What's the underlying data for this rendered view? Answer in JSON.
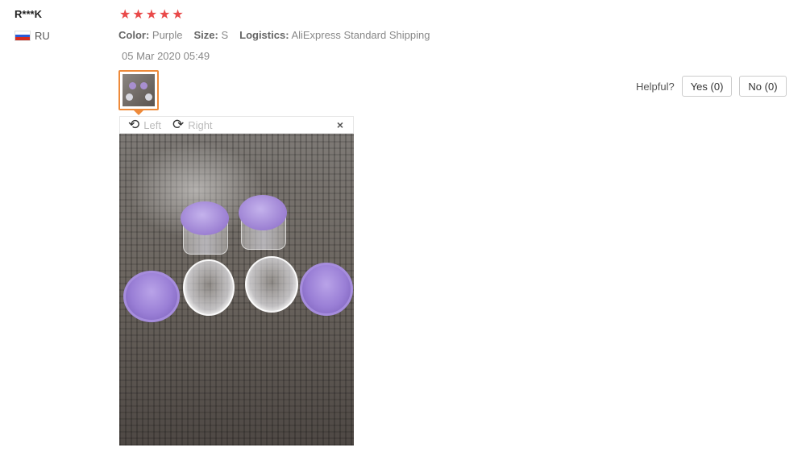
{
  "buyer": {
    "name": "R***K",
    "country": "RU"
  },
  "review": {
    "rating": 5,
    "star_glyph": "★",
    "star_color": "#e94a4a",
    "color_label": "Color:",
    "color_value": "Purple",
    "size_label": "Size:",
    "size_value": "S",
    "logistics_label": "Logistics:",
    "logistics_value": "AliExpress Standard Shipping",
    "date": "05 Mar 2020 05:49"
  },
  "viewer": {
    "rotate_left_label": "Left",
    "rotate_right_label": "Right",
    "close_label": "×"
  },
  "helpful": {
    "label": "Helpful?",
    "yes_label": "Yes (0)",
    "no_label": "No (0)"
  },
  "colors": {
    "accent": "#ee8a3a",
    "lid": "#9b7fd2"
  }
}
